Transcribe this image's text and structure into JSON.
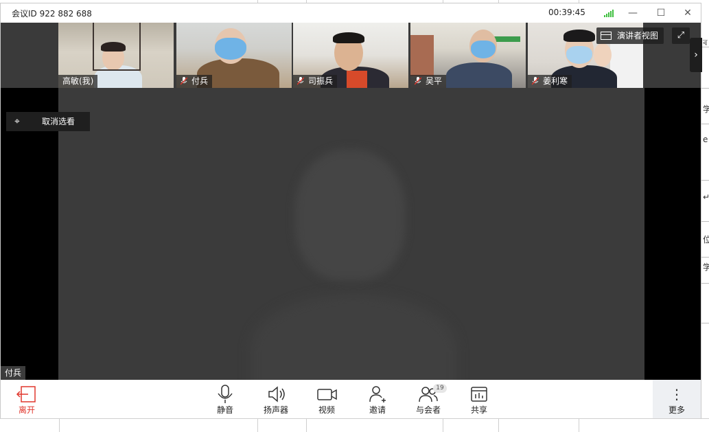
{
  "window": {
    "title": "会议ID 922 882 688",
    "timer": "00:39:45",
    "minimize_glyph": "—",
    "maximize_glyph": "☐",
    "close_glyph": "✕"
  },
  "participants": [
    {
      "name": "高敏(我)",
      "muted": false
    },
    {
      "name": "付兵",
      "muted": true
    },
    {
      "name": "司振兵",
      "muted": true
    },
    {
      "name": "吴平",
      "muted": true
    },
    {
      "name": "姜利寒",
      "muted": true
    }
  ],
  "stage": {
    "view_button_label": "演讲者视图",
    "fullscreen_glyph": "⤢",
    "next_arrow_glyph": "›",
    "unpin_label": "取消选看",
    "unpin_glyph": "⌖",
    "active_speaker": "付兵"
  },
  "toolbar": {
    "leave": "离开",
    "mute": "静音",
    "speaker": "扬声器",
    "video": "视频",
    "invite": "邀请",
    "participants": "与会者",
    "participants_count": "19",
    "share": "共享",
    "more": "更多",
    "more_glyph": "⋮"
  },
  "background_doc": {
    "edge_glyphs": [
      "ৰ",
      "学",
      "e",
      "↵",
      "位",
      "学"
    ]
  },
  "colors": {
    "leave_red": "#e0362c",
    "signal_green": "#3fbf3f",
    "mask_blue": "#6fb3e6"
  }
}
